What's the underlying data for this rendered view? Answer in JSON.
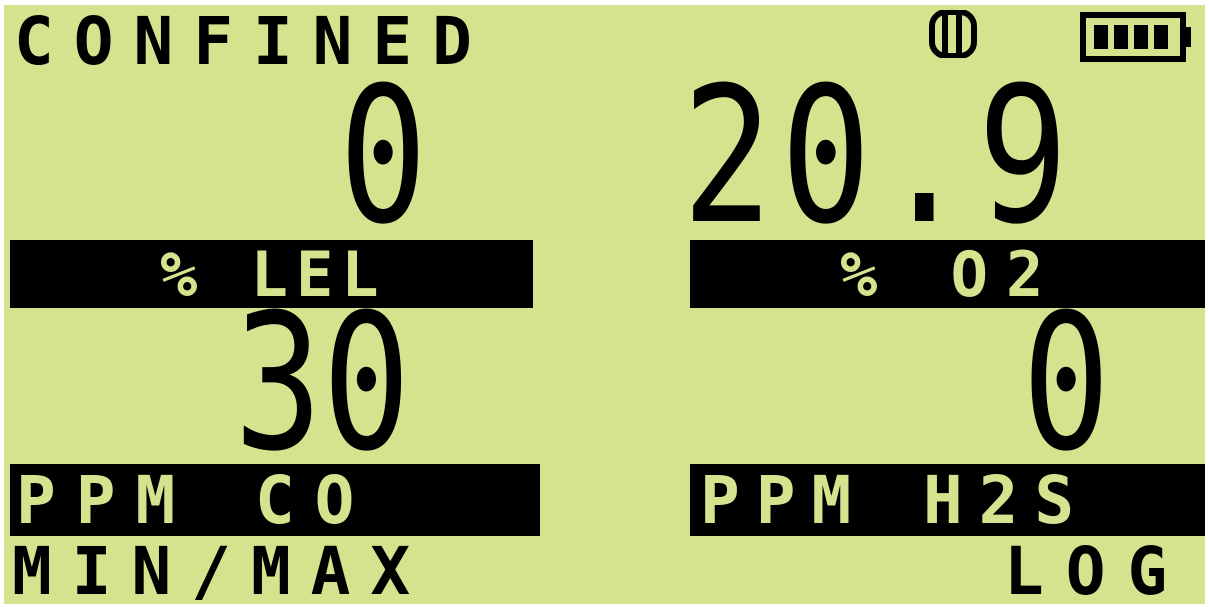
{
  "header": {
    "mode": "CONFINED",
    "icons": [
      "probe-icon",
      "battery-icon"
    ],
    "battery_level": "4/4"
  },
  "sensors": {
    "lel": {
      "value": "0",
      "unit": "% LEL"
    },
    "o2": {
      "value": "20.9",
      "unit": "% O2"
    },
    "co": {
      "value": "30",
      "unit": "PPM CO"
    },
    "h2s": {
      "value": "0",
      "unit": "PPM H2S"
    }
  },
  "softkeys": {
    "left": "MIN/MAX",
    "right": "LOG"
  },
  "colors": {
    "lcd_background": "#d4e48e",
    "segments": "#000000"
  }
}
